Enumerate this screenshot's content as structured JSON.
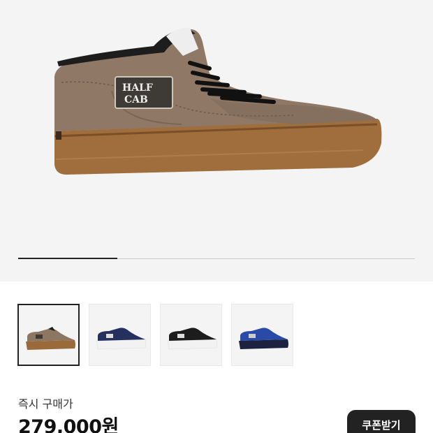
{
  "product": {
    "image_alt": "HALF CAB sneaker",
    "logo_lines": [
      "HALF",
      "CAB"
    ]
  },
  "gallery": {
    "progress": 0.25,
    "thumbnails": [
      {
        "label": "brown",
        "upper": "#8d7662",
        "sole": "#9b6a3a",
        "selected": true
      },
      {
        "label": "navy",
        "upper": "#25305e",
        "sole": "#f2f2f2",
        "selected": false
      },
      {
        "label": "black",
        "upper": "#1c1c1c",
        "sole": "#f2f2f2",
        "selected": false
      },
      {
        "label": "blue",
        "upper": "#2a4aa8",
        "sole": "#1c2340",
        "selected": false
      }
    ]
  },
  "purchase": {
    "price_label": "즉시 구매가",
    "price": "279,000원",
    "coupon_button": "쿠폰받기"
  }
}
